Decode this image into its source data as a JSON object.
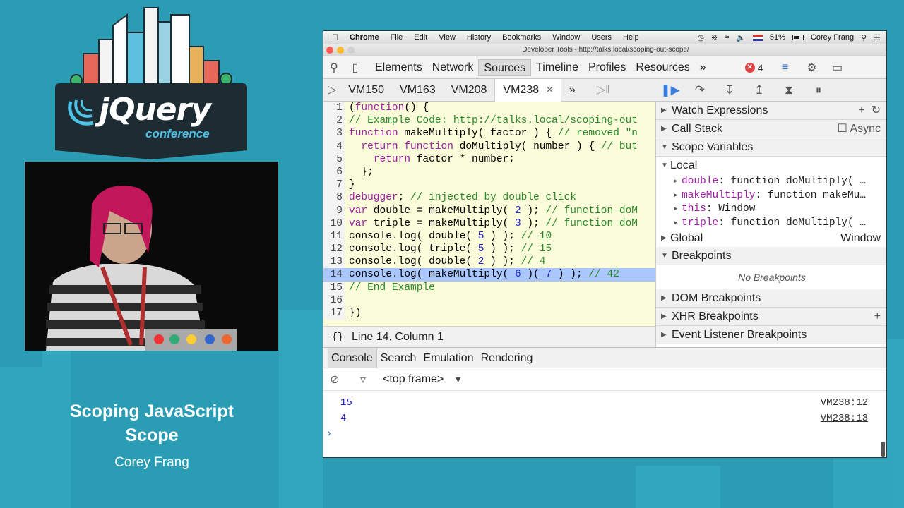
{
  "slide": {
    "logo_text": "jQuery",
    "logo_sub": "conference",
    "talk_title_line1": "Scoping JavaScript",
    "talk_title_line2": "Scope",
    "speaker": "Corey Frang"
  },
  "colors": {
    "slide_bg": "#2a9db4",
    "badge_bg": "#1d2b33",
    "accent": "#4cc3e6",
    "highlight_line": "#aac8ff",
    "code_bg": "#fbfcd9"
  },
  "mac_menubar": {
    "items": [
      "Chrome",
      "File",
      "Edit",
      "View",
      "History",
      "Bookmarks",
      "Window",
      "Users",
      "Help"
    ],
    "battery": "51%",
    "user": "Corey Frang"
  },
  "window": {
    "title": "Developer Tools - http://talks.local/scoping-out-scope/"
  },
  "devtools": {
    "tabs": [
      "Elements",
      "Network",
      "Sources",
      "Timeline",
      "Profiles",
      "Resources"
    ],
    "more": "»",
    "error_count": "4"
  },
  "file_tabs": [
    "VM150",
    "VM163",
    "VM208",
    "VM238"
  ],
  "file_tabs_close": "×",
  "file_tabs_more": "»",
  "code": {
    "lines": [
      {
        "n": "1",
        "text": "(function() {"
      },
      {
        "n": "2",
        "text": "// Example Code: http://talks.local/scoping-out"
      },
      {
        "n": "3",
        "text": "function makeMultiply( factor ) { // removed \"n"
      },
      {
        "n": "4",
        "text": "  return function doMultiply( number ) { // but"
      },
      {
        "n": "5",
        "text": "    return factor * number;"
      },
      {
        "n": "6",
        "text": "  };"
      },
      {
        "n": "7",
        "text": "}"
      },
      {
        "n": "8",
        "text": "debugger; // injected by double click"
      },
      {
        "n": "9",
        "text": "var double = makeMultiply( 2 ); // function doM"
      },
      {
        "n": "10",
        "text": "var triple = makeMultiply( 3 ); // function doM"
      },
      {
        "n": "11",
        "text": "console.log( double( 5 ) ); // 10"
      },
      {
        "n": "12",
        "text": "console.log( triple( 5 ) ); // 15"
      },
      {
        "n": "13",
        "text": "console.log( double( 2 ) ); // 4"
      },
      {
        "n": "14",
        "text": "console.log( makeMultiply( 6 )( 7 ) ); // 42"
      },
      {
        "n": "15",
        "text": "// End Example"
      },
      {
        "n": "16",
        "text": ""
      },
      {
        "n": "17",
        "text": "})"
      }
    ],
    "highlighted_line": "14"
  },
  "status": {
    "braces": "{}",
    "position": "Line 14, Column 1"
  },
  "sidebar": {
    "watch": "Watch Expressions",
    "call_stack": "Call Stack",
    "async": "Async",
    "scope_vars": "Scope Variables",
    "local": "Local",
    "vars": [
      {
        "name": "double",
        "value": "function doMultiply( …"
      },
      {
        "name": "makeMultiply",
        "value": "function makeMu…"
      },
      {
        "name": "this",
        "value": "Window"
      },
      {
        "name": "triple",
        "value": "function doMultiply( …"
      }
    ],
    "global": "Global",
    "global_value": "Window",
    "breakpoints": "Breakpoints",
    "no_breakpoints": "No Breakpoints",
    "dom_bp": "DOM Breakpoints",
    "xhr_bp": "XHR Breakpoints",
    "event_bp": "Event Listener Breakpoints"
  },
  "drawer": {
    "tabs": [
      "Console",
      "Search",
      "Emulation",
      "Rendering"
    ],
    "frame": "<top frame>",
    "output": [
      {
        "value": "15",
        "source": "VM238:12"
      },
      {
        "value": "4",
        "source": "VM238:13"
      }
    ],
    "prompt": "›"
  }
}
